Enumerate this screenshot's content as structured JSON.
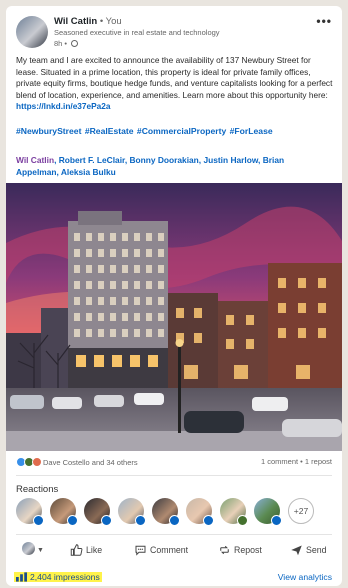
{
  "author": {
    "name": "Wil Catlin",
    "connection": "• You",
    "headline": "Seasoned executive in real estate and technology",
    "time": "8h •"
  },
  "post": {
    "body": "My team and I are excited to announce the availability of 137 Newbury Street for lease. Situated in a prime location, this property is ideal for private family offices, private equity firms, boutique hedge funds, and venture capitalists looking for a perfect blend of location, experience, and amenities. Learn more about this opportunity here: ",
    "link": "https://lnkd.in/e37ePa2a",
    "hashtags": "#NewburyStreet #RealEstate #CommercialProperty #ForLease",
    "mentions_first": "Wil Catlin",
    "mentions_rest": ", Robert F. LeClair, Bonny Doorakian, Justin Harlow, Brian Appelman, Aleksia Bulku"
  },
  "social": {
    "reactors_text": "Dave Costello and 34 others",
    "comments_reposts": "1 comment • 1 repost"
  },
  "reactions": {
    "title": "Reactions",
    "more_count": "+27"
  },
  "actions": {
    "like": "Like",
    "comment": "Comment",
    "repost": "Repost",
    "send": "Send"
  },
  "footer": {
    "impressions": "2,404 impressions",
    "view_analytics": "View analytics"
  },
  "colors": {
    "link": "#0a66c2",
    "highlight": "#fff34a",
    "mention_self": "#7b3fa0"
  },
  "icons": [
    "more-icon",
    "globe-icon",
    "like-icon",
    "comment-icon",
    "repost-icon",
    "send-icon",
    "bar-chart-icon",
    "caret-down-icon"
  ]
}
